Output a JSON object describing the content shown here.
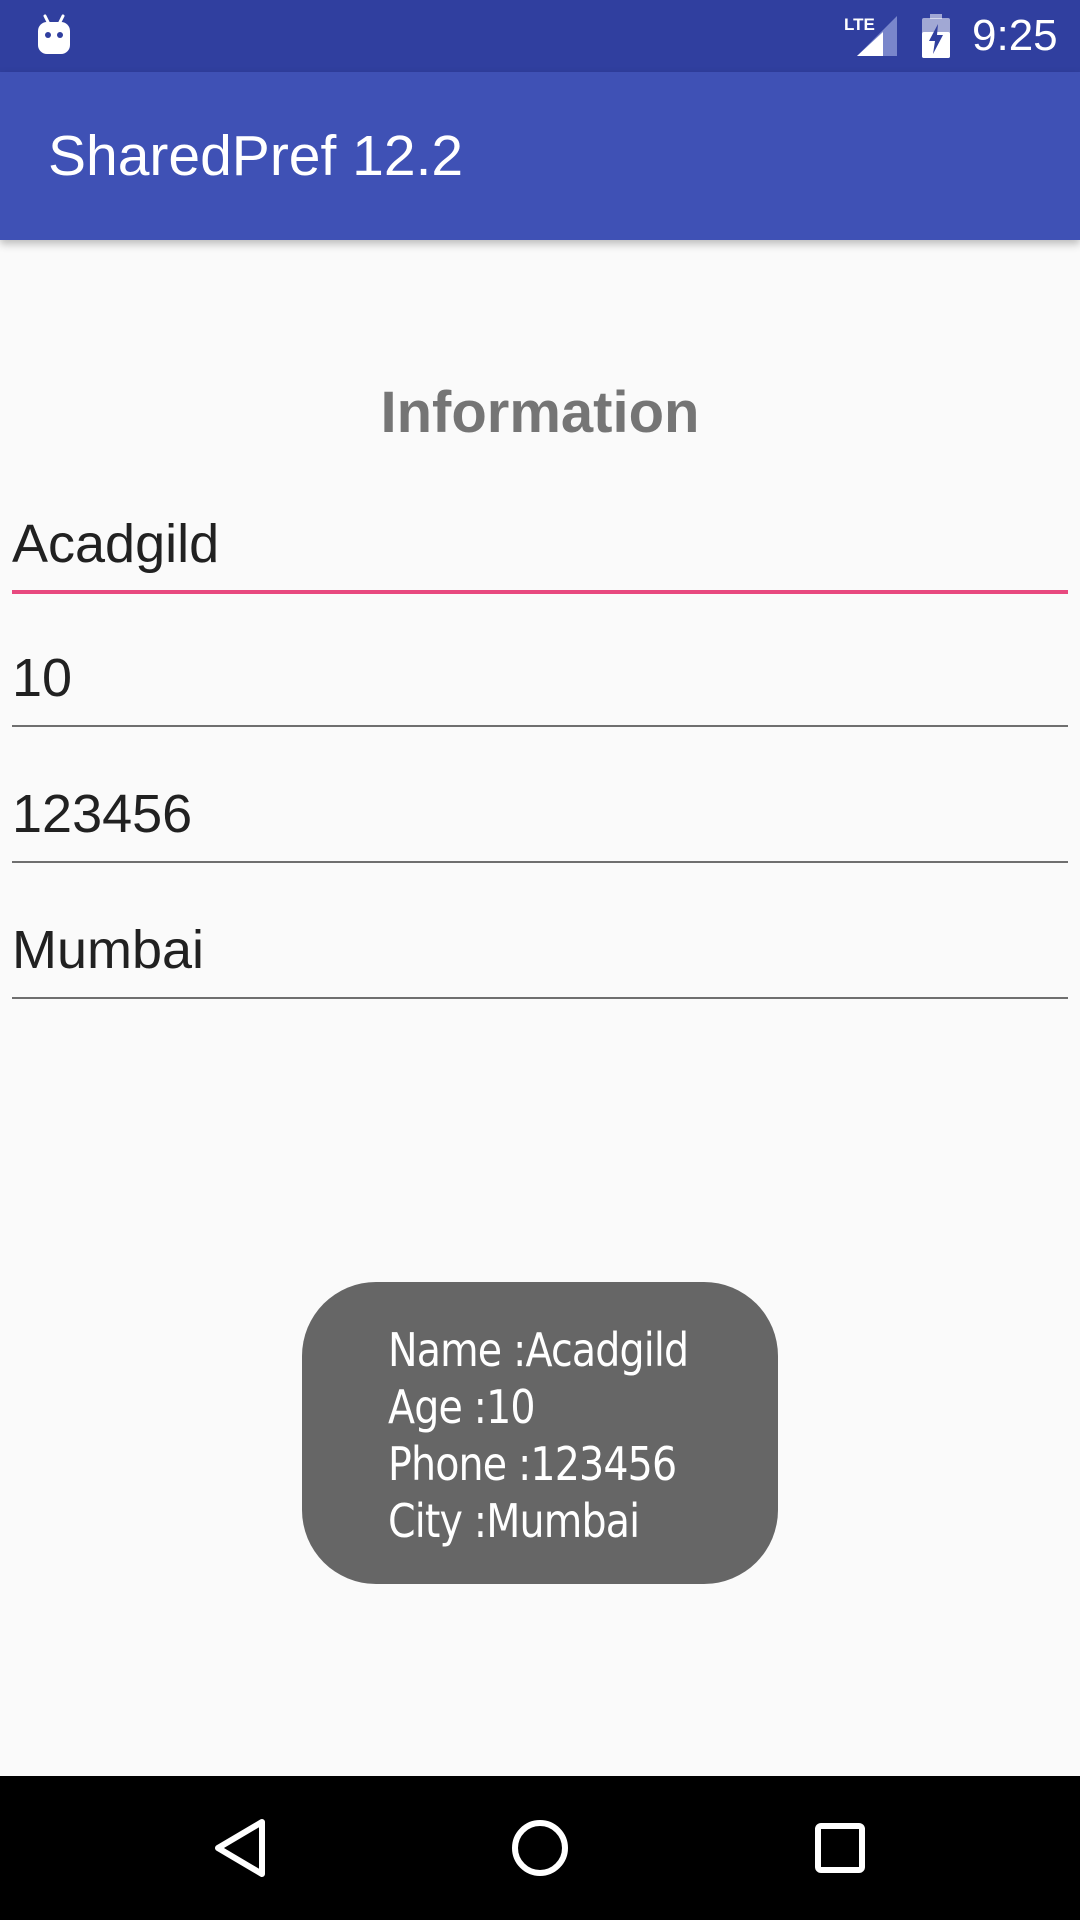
{
  "status_bar": {
    "time": "9:25",
    "network_label": "LTE",
    "notification_icon": "android-icon",
    "battery_icon": "battery-charging-icon",
    "signal_icon": "signal-icon"
  },
  "app_bar": {
    "title": "SharedPref 12.2",
    "color": "#3f51b5"
  },
  "content": {
    "heading": "Information",
    "fields": [
      {
        "value": "Acadgild",
        "focused": true
      },
      {
        "value": "10",
        "focused": false
      },
      {
        "value": "123456",
        "focused": false
      },
      {
        "value": "Mumbai",
        "focused": false
      }
    ],
    "accent_color": "#e8497f"
  },
  "toast": {
    "lines": [
      "Name :Acadgild",
      "Age :10",
      "Phone :123456",
      "City :Mumbai"
    ]
  },
  "nav_bar": {
    "buttons": [
      "back-icon",
      "home-icon",
      "recents-icon"
    ]
  }
}
